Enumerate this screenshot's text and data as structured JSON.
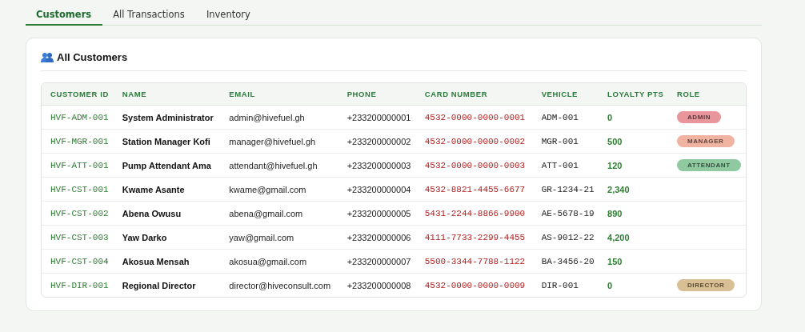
{
  "tabs": [
    {
      "label": "Customers",
      "selected": true
    },
    {
      "label": "All Transactions",
      "selected": false
    },
    {
      "label": "Inventory",
      "selected": false
    }
  ],
  "card": {
    "title": "All Customers"
  },
  "table": {
    "columns": [
      "CUSTOMER ID",
      "NAME",
      "EMAIL",
      "PHONE",
      "CARD NUMBER",
      "VEHICLE",
      "LOYALTY PTS",
      "ROLE"
    ],
    "rows": [
      {
        "id": "HVF-ADM-001",
        "name": "System Administrator",
        "email": "admin@hivefuel.gh",
        "phone": "+233200000001",
        "card": "4532-0000-0000-0001",
        "vehicle": "ADM-001",
        "points": "0",
        "role": {
          "label": "ADMIN",
          "color": "#e8959c"
        }
      },
      {
        "id": "HVF-MGR-001",
        "name": "Station Manager Kofi",
        "email": "manager@hivefuel.gh",
        "phone": "+233200000002",
        "card": "4532-0000-0000-0002",
        "vehicle": "MGR-001",
        "points": "500",
        "role": {
          "label": "MANAGER",
          "color": "#f0b3a2"
        }
      },
      {
        "id": "HVF-ATT-001",
        "name": "Pump Attendant Ama",
        "email": "attendant@hivefuel.gh",
        "phone": "+233200000003",
        "card": "4532-0000-0000-0003",
        "vehicle": "ATT-001",
        "points": "120",
        "role": {
          "label": "ATTENDANT",
          "color": "#8fc9a0"
        }
      },
      {
        "id": "HVF-CST-001",
        "name": "Kwame Asante",
        "email": "kwame@gmail.com",
        "phone": "+233200000004",
        "card": "4532-8821-4455-6677",
        "vehicle": "GR-1234-21",
        "points": "2,340"
      },
      {
        "id": "HVF-CST-002",
        "name": "Abena Owusu",
        "email": "abena@gmail.com",
        "phone": "+233200000005",
        "card": "5431-2244-8866-9900",
        "vehicle": "AE-5678-19",
        "points": "890"
      },
      {
        "id": "HVF-CST-003",
        "name": "Yaw Darko",
        "email": "yaw@gmail.com",
        "phone": "+233200000006",
        "card": "4111-7733-2299-4455",
        "vehicle": "AS-9012-22",
        "points": "4,200"
      },
      {
        "id": "HVF-CST-004",
        "name": "Akosua Mensah",
        "email": "akosua@gmail.com",
        "phone": "+233200000007",
        "card": "5500-3344-7788-1122",
        "vehicle": "BA-3456-20",
        "points": "150"
      },
      {
        "id": "HVF-DIR-001",
        "name": "Regional Director",
        "email": "director@hiveconsult.com",
        "phone": "+233200000008",
        "card": "4532-0000-0000-0009",
        "vehicle": "DIR-001",
        "points": "0",
        "role": {
          "label": "DIRECTOR",
          "color": "#d9bf94"
        }
      }
    ]
  }
}
